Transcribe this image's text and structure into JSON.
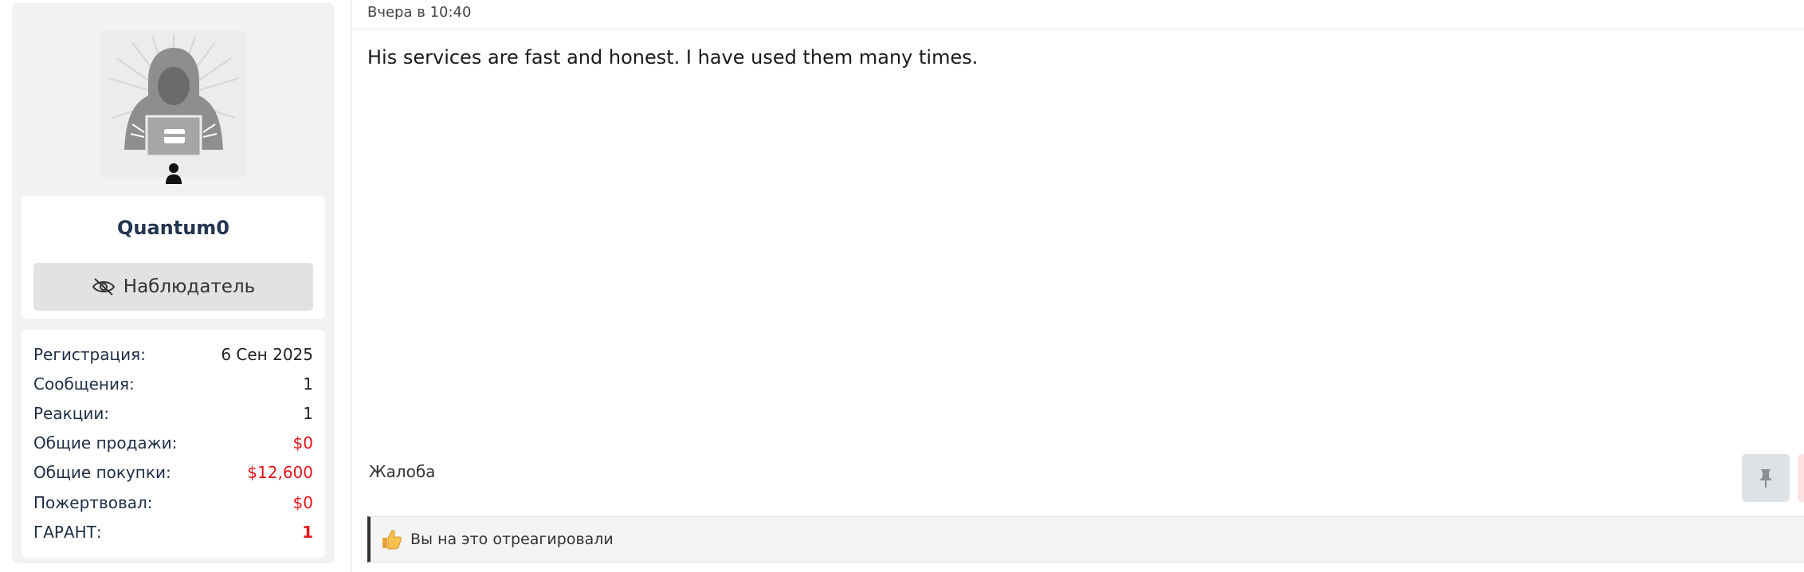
{
  "user": {
    "name": "Quantum0",
    "role": "Наблюдатель",
    "avatar_icon": "hooded-hacker-avatar",
    "status_icon": "user-icon",
    "role_icon": "eye-slash-icon"
  },
  "stats": [
    {
      "label": "Регистрация:",
      "value": "6 Сен 2025",
      "style": "normal"
    },
    {
      "label": "Сообщения:",
      "value": "1",
      "style": "normal"
    },
    {
      "label": "Реакции:",
      "value": "1",
      "style": "normal"
    },
    {
      "label": "Общие продажи:",
      "value": "$0",
      "style": "red"
    },
    {
      "label": "Общие покупки:",
      "value": "$12,600",
      "style": "red"
    },
    {
      "label": "Пожертвовал:",
      "value": "$0",
      "style": "red"
    },
    {
      "label": "ГАРАНТ:",
      "value": "1",
      "style": "red-bold"
    }
  ],
  "post": {
    "date": "Вчера в 10:40",
    "text": "His services are fast and honest. I have used them many times.",
    "report_label": "Жалоба",
    "pin_icon": "pin-icon"
  },
  "reactions": {
    "icon": "thumbs-up-icon",
    "text": "Вы на это отреагировали"
  },
  "colors": {
    "accent_red": "#e3151a",
    "username": "#23354f",
    "sidebar_bg": "#f2f2f2"
  }
}
